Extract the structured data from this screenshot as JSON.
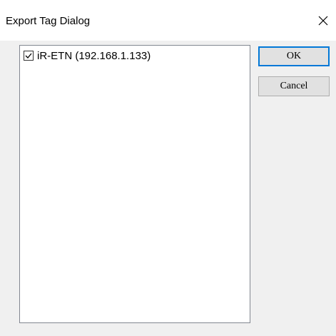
{
  "window": {
    "title": "Export Tag Dialog",
    "close_icon": "close-icon"
  },
  "list": {
    "items": [
      {
        "label": "iR-ETN (192.168.1.133)",
        "checked": true
      }
    ]
  },
  "buttons": {
    "ok_label": "OK",
    "cancel_label": "Cancel"
  },
  "colors": {
    "dialog_bg": "#f0f0f0",
    "titlebar_bg": "#ffffff",
    "button_bg": "#e1e1e1",
    "default_button_border": "#0078d7"
  }
}
